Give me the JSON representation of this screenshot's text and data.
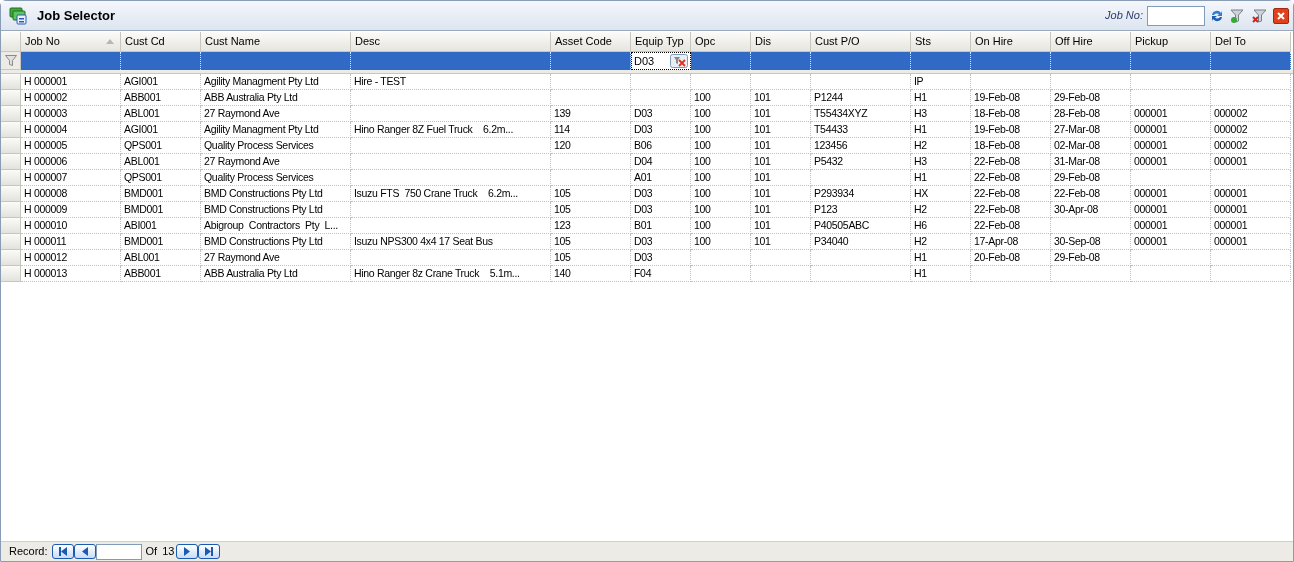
{
  "window": {
    "title": "Job Selector"
  },
  "toolbar": {
    "job_no_label": "Job No:"
  },
  "table": {
    "columns": [
      {
        "label": "Job No",
        "sorted_ascending": true
      },
      {
        "label": "Cust Cd"
      },
      {
        "label": "Cust Name"
      },
      {
        "label": "Desc"
      },
      {
        "label": "Asset Code"
      },
      {
        "label": "Equip Typ"
      },
      {
        "label": "Opc"
      },
      {
        "label": "Dis"
      },
      {
        "label": "Cust P/O"
      },
      {
        "label": "Sts"
      },
      {
        "label": "On Hire"
      },
      {
        "label": "Off Hire"
      },
      {
        "label": "Pickup"
      },
      {
        "label": "Del To"
      }
    ],
    "filter_row": {
      "selected": true,
      "cells": [
        null,
        null,
        null,
        null,
        null,
        "D03",
        null,
        null,
        null,
        null,
        null,
        null,
        null,
        null
      ]
    },
    "rows": [
      [
        "H 000001",
        "AGI001",
        "Agility Managment Pty Ltd",
        "Hire - TEST",
        null,
        null,
        null,
        null,
        null,
        "IP",
        null,
        null,
        null,
        null
      ],
      [
        "H 000002",
        "ABB001",
        "ABB Australia Pty Ltd",
        null,
        null,
        null,
        "100",
        "101",
        "P1244",
        "H1",
        "19-Feb-08",
        "29-Feb-08",
        null,
        null
      ],
      [
        "H 000003",
        "ABL001",
        "27 Raymond Ave",
        null,
        "139",
        "D03",
        "100",
        "101",
        "T55434XYZ",
        "H3",
        "18-Feb-08",
        "28-Feb-08",
        "000001",
        "000002"
      ],
      [
        "H 000004",
        "AGI001",
        "Agility Managment Pty Ltd",
        "Hino Ranger 8Z Fuel Truck    6.2m...",
        "114",
        "D03",
        "100",
        "101",
        "T54433",
        "H1",
        "19-Feb-08",
        "27-Mar-08",
        "000001",
        "000002"
      ],
      [
        "H 000005",
        "QPS001",
        "Quality Process Services",
        null,
        "120",
        "B06",
        "100",
        "101",
        "123456",
        "H2",
        "18-Feb-08",
        "02-Mar-08",
        "000001",
        "000002"
      ],
      [
        "H 000006",
        "ABL001",
        "27 Raymond Ave",
        null,
        null,
        "D04",
        "100",
        "101",
        "P5432",
        "H3",
        "22-Feb-08",
        "31-Mar-08",
        "000001",
        "000001"
      ],
      [
        "H 000007",
        "QPS001",
        "Quality Process Services",
        null,
        null,
        "A01",
        "100",
        "101",
        null,
        "H1",
        "22-Feb-08",
        "29-Feb-08",
        null,
        null
      ],
      [
        "H 000008",
        "BMD001",
        "BMD Constructions Pty Ltd",
        "Isuzu FTS  750 Crane Truck    6.2m...",
        "105",
        "D03",
        "100",
        "101",
        "P293934",
        "HX",
        "22-Feb-08",
        "22-Feb-08",
        "000001",
        "000001"
      ],
      [
        "H 000009",
        "BMD001",
        "BMD Constructions Pty Ltd",
        null,
        "105",
        "D03",
        "100",
        "101",
        "P123",
        "H2",
        "22-Feb-08",
        "30-Apr-08",
        "000001",
        "000001"
      ],
      [
        "H 000010",
        "ABI001",
        "Abigroup  Contractors  Pty  L...",
        null,
        "123",
        "B01",
        "100",
        "101",
        "P40505ABC",
        "H6",
        "22-Feb-08",
        null,
        "000001",
        "000001"
      ],
      [
        "H 000011",
        "BMD001",
        "BMD Constructions Pty Ltd",
        "Isuzu NPS300 4x4 17 Seat Bus",
        "105",
        "D03",
        "100",
        "101",
        "P34040",
        "H2",
        "17-Apr-08",
        "30-Sep-08",
        "000001",
        "000001"
      ],
      [
        "H 000012",
        "ABL001",
        "27 Raymond Ave",
        null,
        "105",
        "D03",
        null,
        null,
        null,
        "H1",
        "20-Feb-08",
        "29-Feb-08",
        null,
        null
      ],
      [
        "H 000013",
        "ABB001",
        "ABB Australia Pty Ltd",
        "Hino Ranger 8z Crane Truck    5.1m...",
        "140",
        "F04",
        null,
        null,
        null,
        "H1",
        null,
        null,
        null,
        null
      ]
    ]
  },
  "navigator": {
    "label": "Record:",
    "of_label": "Of",
    "total": "13"
  }
}
